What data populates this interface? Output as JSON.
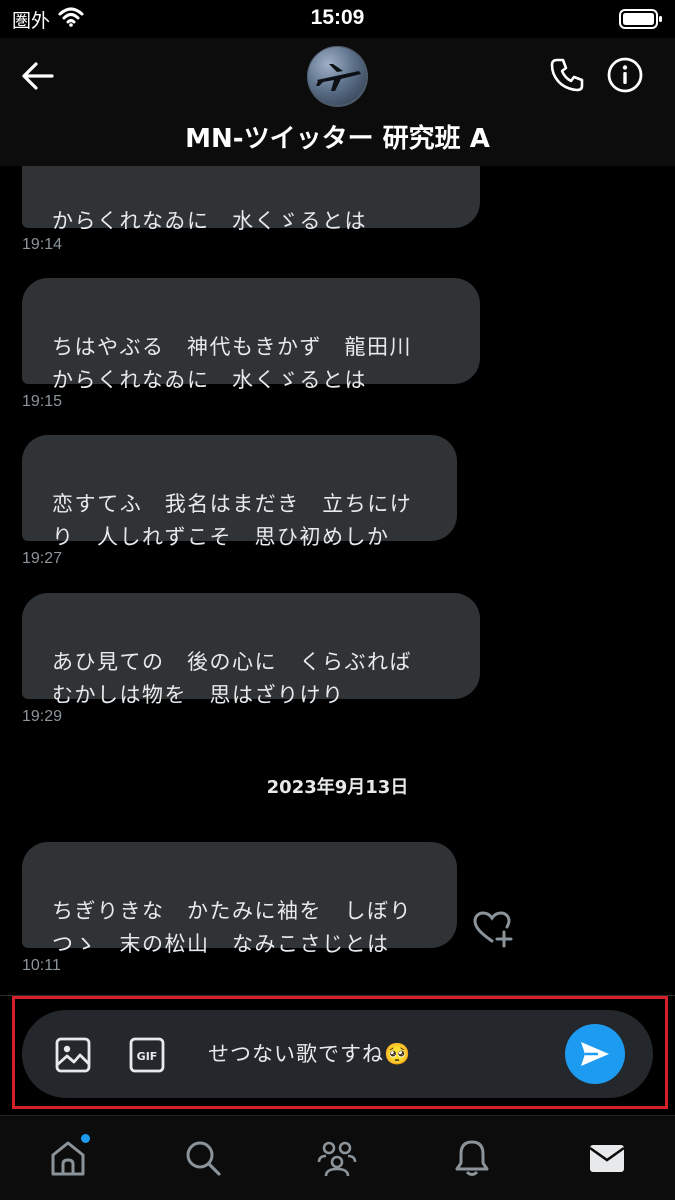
{
  "status": {
    "carrier": "圏外",
    "time": "15:09"
  },
  "header": {
    "title": "MN-ツイッター 研究班 A"
  },
  "messages": [
    {
      "text": "からくれなゐに　水くゞるとは",
      "time": "19:14"
    },
    {
      "text": "ちはやぶる　神代もきかず　龍田川\nからくれなゐに　水くゞるとは",
      "time": "19:15"
    },
    {
      "text": "恋すてふ　我名はまだき　立ちにけ\nり　人しれずこそ　思ひ初めしか",
      "time": "19:27"
    },
    {
      "text": "あひ見ての　後の心に　くらぶれば\nむかしは物を　思はざりけり",
      "time": "19:29"
    }
  ],
  "date_separator": "2023年9月13日",
  "last_message": {
    "text": "ちぎりきな　かたみに袖を　しぼり\nつゝ　末の松山　なみこさじとは",
    "time": "10:11"
  },
  "composer": {
    "value": "せつない歌ですね🥺"
  },
  "colors": {
    "accent": "#1d9bf0",
    "bubble": "#2f3336",
    "highlight": "#d5202a"
  }
}
